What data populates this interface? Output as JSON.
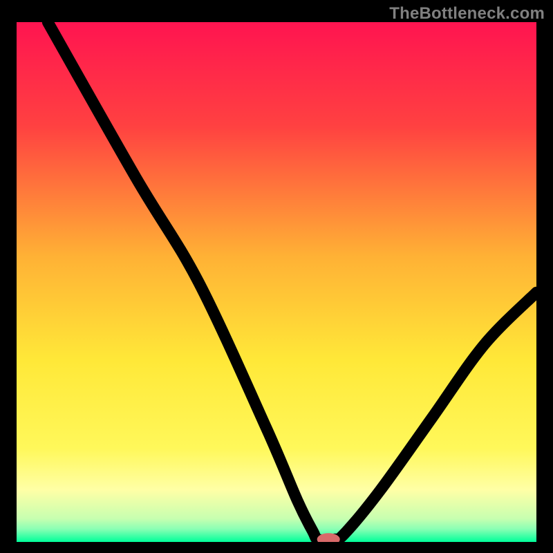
{
  "watermark": {
    "text": "TheBottleneck.com"
  },
  "chart_data": {
    "type": "line",
    "title": "",
    "xlabel": "",
    "ylabel": "",
    "xlim": [
      0,
      100
    ],
    "ylim": [
      0,
      100
    ],
    "gradient_stops": [
      {
        "offset": 0,
        "color": "#ff1450"
      },
      {
        "offset": 20,
        "color": "#ff4141"
      },
      {
        "offset": 45,
        "color": "#ffb135"
      },
      {
        "offset": 65,
        "color": "#ffe838"
      },
      {
        "offset": 82,
        "color": "#fff85a"
      },
      {
        "offset": 90,
        "color": "#ffffa6"
      },
      {
        "offset": 95.5,
        "color": "#c7ffb0"
      },
      {
        "offset": 97.5,
        "color": "#8affb4"
      },
      {
        "offset": 100,
        "color": "#00ff9a"
      }
    ],
    "series": [
      {
        "name": "bottleneck-curve",
        "points": [
          {
            "x": 6,
            "y": 100
          },
          {
            "x": 23,
            "y": 70
          },
          {
            "x": 35,
            "y": 50
          },
          {
            "x": 48,
            "y": 22
          },
          {
            "x": 54,
            "y": 8
          },
          {
            "x": 57,
            "y": 2
          },
          {
            "x": 58,
            "y": 0.5
          },
          {
            "x": 61,
            "y": 0.5
          },
          {
            "x": 63,
            "y": 1.5
          },
          {
            "x": 70,
            "y": 10
          },
          {
            "x": 80,
            "y": 24
          },
          {
            "x": 90,
            "y": 38
          },
          {
            "x": 100,
            "y": 48
          }
        ]
      }
    ],
    "marker": {
      "x": 60,
      "y": 0.5,
      "rx": 2.2,
      "ry": 1.2,
      "color": "#d96a6a"
    }
  }
}
